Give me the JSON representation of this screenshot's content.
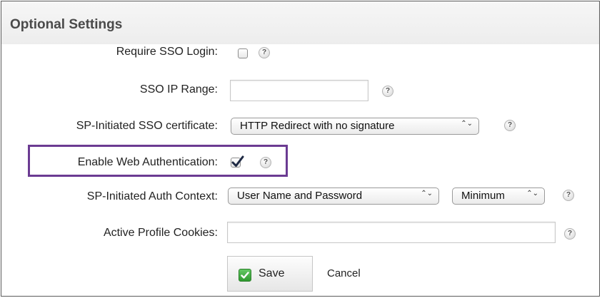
{
  "section": {
    "title": "Optional Settings"
  },
  "rows": {
    "require_sso": {
      "label": "Require SSO Login:",
      "checked": false
    },
    "sso_ip_range": {
      "label": "SSO IP Range:",
      "value": ""
    },
    "sp_cert": {
      "label": "SP-Initiated SSO certificate:",
      "selected": "HTTP Redirect with no signature"
    },
    "web_auth": {
      "label": "Enable Web Authentication:",
      "checked": true
    },
    "auth_context": {
      "label": "SP-Initiated Auth Context:",
      "selected": "User Name and Password",
      "level": "Minimum"
    },
    "cookies": {
      "label": "Active Profile Cookies:",
      "value": ""
    }
  },
  "help_glyph": "?",
  "select_arrows": "⌃⌄",
  "actions": {
    "save_label": "Save",
    "cancel_label": "Cancel"
  },
  "colors": {
    "highlight": "#6b3b92",
    "save_icon": "#3aa43a"
  },
  "icons": {
    "help": "question-icon",
    "save": "check-icon"
  }
}
